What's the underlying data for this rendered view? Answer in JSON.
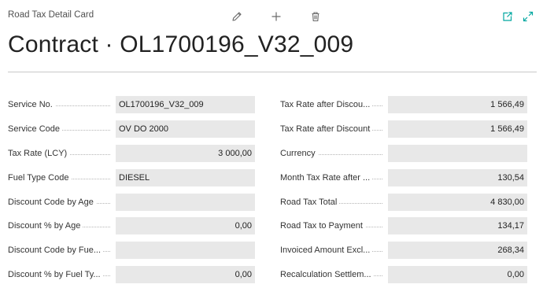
{
  "header": {
    "page_caption": "Road Tax Detail Card",
    "title": "Contract · OL1700196_V32_009"
  },
  "toolbar": {
    "icons": [
      "pencil-edit-icon",
      "plus-new-icon",
      "trash-delete-icon",
      "open-in-new-icon",
      "expand-icon"
    ]
  },
  "fields_left": [
    {
      "label": "Service No.",
      "value": "OL1700196_V32_009"
    },
    {
      "label": "Service Code",
      "value": "OV DO 2000"
    },
    {
      "label": "Tax Rate (LCY)",
      "value": "3 000,00"
    },
    {
      "label": "Fuel Type Code",
      "value": "DIESEL"
    },
    {
      "label": "Discount Code by Age",
      "value": ""
    },
    {
      "label": "Discount % by Age",
      "value": "0,00"
    },
    {
      "label": "Discount Code by Fue...",
      "value": ""
    },
    {
      "label": "Discount % by Fuel Ty...",
      "value": "0,00"
    }
  ],
  "fields_right": [
    {
      "label": "Tax Rate after Discou...",
      "value": "1 566,49"
    },
    {
      "label": "Tax Rate after Discount",
      "value": "1 566,49"
    },
    {
      "label": "Currency",
      "value": ""
    },
    {
      "label": "Month Tax Rate after ...",
      "value": "130,54"
    },
    {
      "label": "Road Tax Total",
      "value": "4 830,00"
    },
    {
      "label": "Road Tax to Payment",
      "value": "134,17"
    },
    {
      "label": "Invoiced Amount Excl...",
      "value": "268,34"
    },
    {
      "label": "Recalculation Settlem...",
      "value": "0,00"
    }
  ],
  "colors": {
    "accent": "#00a7a0",
    "field_background": "#e8e8e8",
    "icon_gray": "#6b6b6b"
  }
}
